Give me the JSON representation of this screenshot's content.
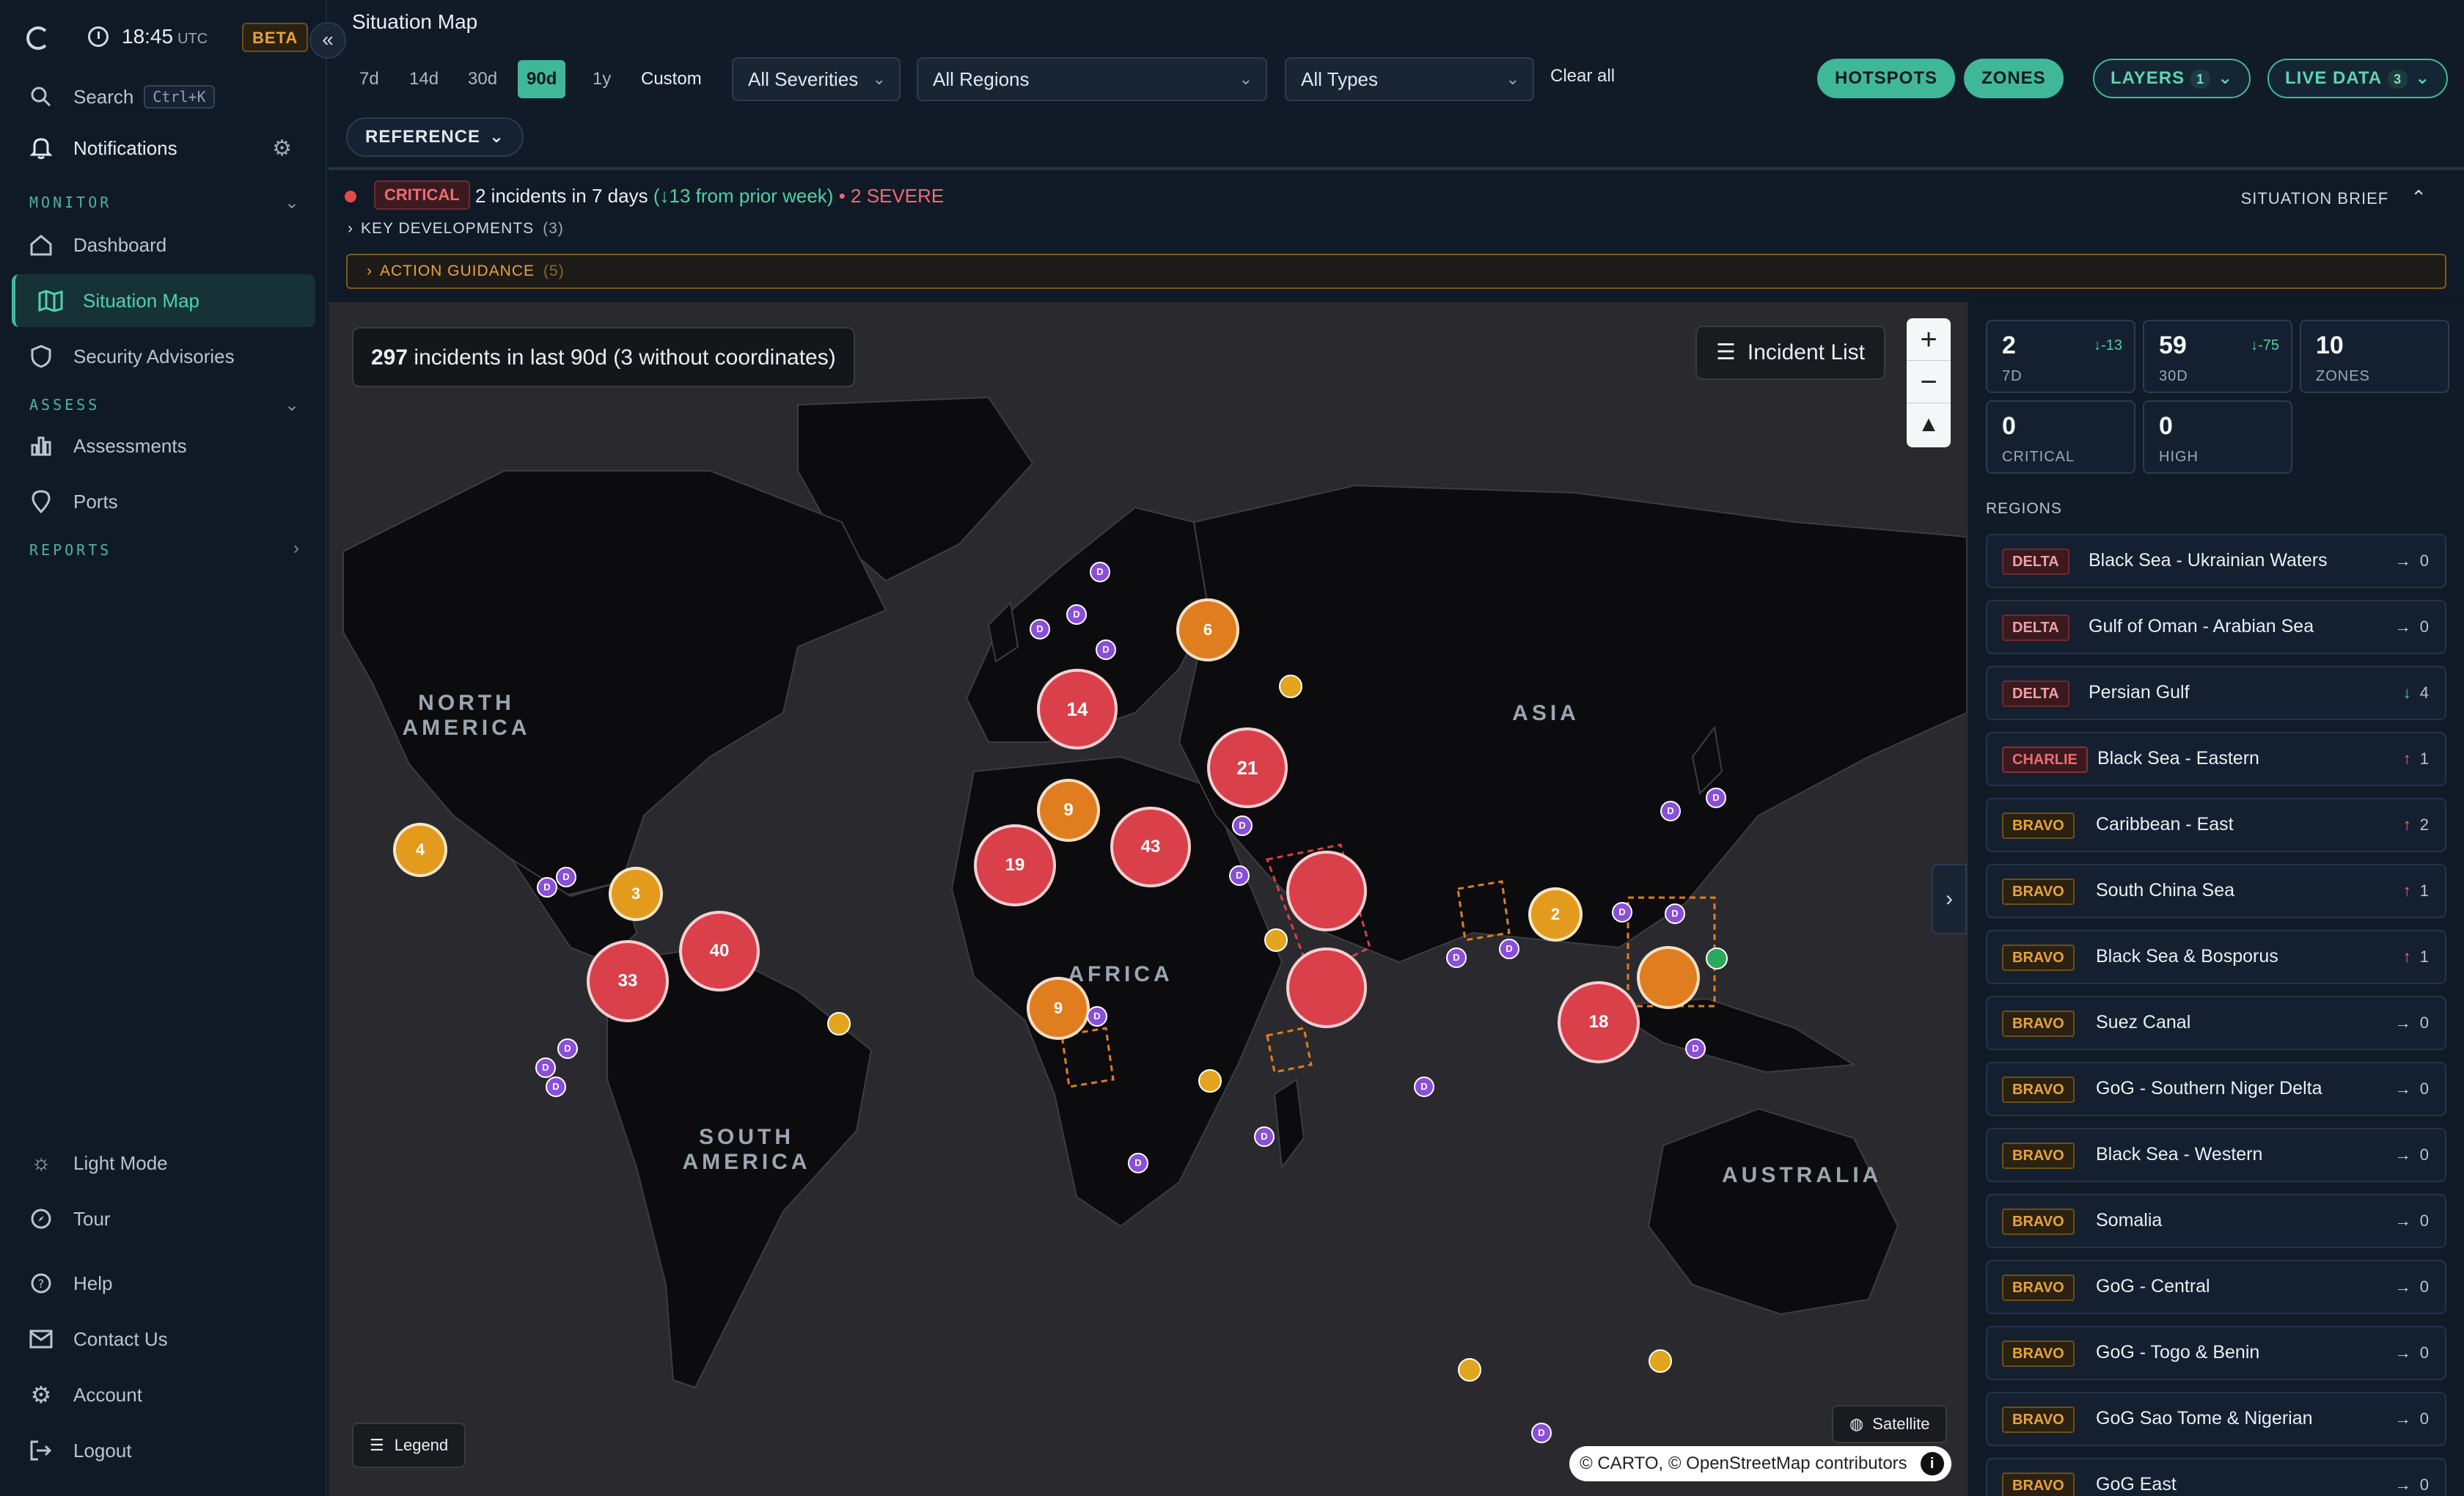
{
  "sidebar": {
    "clock_time": "18:45",
    "clock_zone": "UTC",
    "beta": "BETA",
    "search_label": "Search",
    "search_shortcut": "Ctrl+K",
    "notifications_label": "Notifications",
    "monitor_section": "MONITOR",
    "dashboard_label": "Dashboard",
    "situation_map_label": "Situation Map",
    "security_advisories_label": "Security Advisories",
    "assess_section": "ASSESS",
    "assessments_label": "Assessments",
    "ports_label": "Ports",
    "reports_section": "REPORTS",
    "light_mode_label": "Light Mode",
    "tour_label": "Tour",
    "help_label": "Help",
    "contact_label": "Contact Us",
    "account_label": "Account",
    "logout_label": "Logout"
  },
  "header": {
    "title": "Situation Map",
    "ranges": [
      "7d",
      "14d",
      "30d",
      "90d",
      "1y",
      "Custom"
    ],
    "active_range": "90d",
    "severity_filter": "All Severities",
    "region_filter": "All Regions",
    "type_filter": "All Types",
    "clear_all": "Clear all",
    "hotspots": "HOTSPOTS",
    "zones": "ZONES",
    "layers": "LAYERS",
    "layers_count": "1",
    "live_data": "LIVE DATA",
    "live_data_count": "3",
    "reference": "REFERENCE"
  },
  "brief": {
    "level": "CRITICAL",
    "summary": "2 incidents in 7 days",
    "change": "(↓13 from prior week)",
    "severe": "• 2 SEVERE",
    "situation_brief": "SITUATION BRIEF",
    "key_developments": "KEY DEVELOPMENTS",
    "key_developments_count": "(3)",
    "action_guidance": "ACTION GUIDANCE",
    "action_guidance_count": "(5)"
  },
  "map": {
    "incident_count": "297",
    "incident_text": "incidents in last 90d (3 without coordinates)",
    "incident_list": "Incident List",
    "legend": "Legend",
    "satellite": "Satellite",
    "attribution": "© CARTO, © OpenStreetMap contributors",
    "labels": {
      "north_america": "NORTH AMERICA",
      "south_america": "SOUTH AMERICA",
      "africa": "AFRICA",
      "asia": "ASIA",
      "australia": "AUSTRALIA"
    },
    "cluster_counts": [
      "14",
      "21",
      "9",
      "43",
      "19",
      "6",
      "4",
      "3",
      "33",
      "40",
      "9",
      "2",
      "18"
    ],
    "marker_letter": "D"
  },
  "stats": {
    "d7": {
      "value": "2",
      "label": "7D",
      "delta": "↓-13"
    },
    "d30": {
      "value": "59",
      "label": "30D",
      "delta": "↓-75"
    },
    "zones": {
      "value": "10",
      "label": "ZONES"
    },
    "critical": {
      "value": "0",
      "label": "CRITICAL"
    },
    "high": {
      "value": "0",
      "label": "HIGH"
    }
  },
  "regions_header": "REGIONS",
  "regions": [
    {
      "level": "DELTA",
      "name": "Black Sea - Ukrainian Waters",
      "arrow": "→",
      "count": "0"
    },
    {
      "level": "DELTA",
      "name": "Gulf of Oman - Arabian Sea",
      "arrow": "→",
      "count": "0"
    },
    {
      "level": "DELTA",
      "name": "Persian Gulf",
      "arrow": "↓",
      "count": "4"
    },
    {
      "level": "CHARLIE",
      "name": "Black Sea - Eastern",
      "arrow": "↑",
      "count": "1"
    },
    {
      "level": "BRAVO",
      "name": "Caribbean - East",
      "arrow": "↑",
      "count": "2"
    },
    {
      "level": "BRAVO",
      "name": "South China Sea",
      "arrow": "↑",
      "count": "1"
    },
    {
      "level": "BRAVO",
      "name": "Black Sea & Bosporus",
      "arrow": "↑",
      "count": "1"
    },
    {
      "level": "BRAVO",
      "name": "Suez Canal",
      "arrow": "→",
      "count": "0"
    },
    {
      "level": "BRAVO",
      "name": "GoG - Southern Niger Delta",
      "arrow": "→",
      "count": "0"
    },
    {
      "level": "BRAVO",
      "name": "Black Sea - Western",
      "arrow": "→",
      "count": "0"
    },
    {
      "level": "BRAVO",
      "name": "Somalia",
      "arrow": "→",
      "count": "0"
    },
    {
      "level": "BRAVO",
      "name": "GoG - Central",
      "arrow": "→",
      "count": "0"
    },
    {
      "level": "BRAVO",
      "name": "GoG - Togo & Benin",
      "arrow": "→",
      "count": "0"
    },
    {
      "level": "BRAVO",
      "name": "GoG Sao Tome & Nigerian",
      "arrow": "→",
      "count": "0"
    },
    {
      "level": "BRAVO",
      "name": "GoG East",
      "arrow": "→",
      "count": "0"
    }
  ],
  "colors": {
    "accent": "#3fb89a",
    "critical": "#e5484d",
    "bravo": "#e8a33a",
    "map_bg": "#2a2a2e",
    "land": "#0c0c0e"
  }
}
